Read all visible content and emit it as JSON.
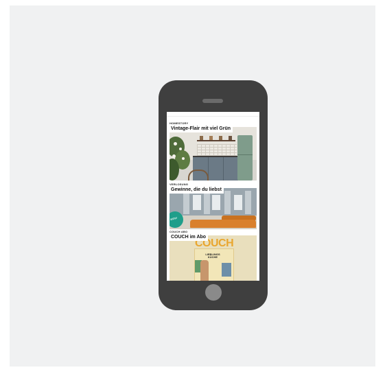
{
  "device": "phone-mockup",
  "feed": [
    {
      "kicker": "HOMESTORY",
      "headline": "Vintage-Flair mit viel Grün",
      "image": "kitchen-photo"
    },
    {
      "kicker": "VERLOSUNG",
      "headline": "Gewinne, die du liebst",
      "image": "showroom-photo",
      "badge_text": "wow"
    },
    {
      "kicker": "COUCH ABO",
      "headline": "COUCH im Abo",
      "image": "magazine-cover",
      "magazine_title": "COUCH",
      "magazine_subtitle": "LIEBLINGS KÜCHE"
    }
  ],
  "colors": {
    "phone": "#3f3f3f",
    "background": "#f0f1f2",
    "accent_orange": "#e9a62e",
    "badge_green": "#1f9e8a"
  }
}
